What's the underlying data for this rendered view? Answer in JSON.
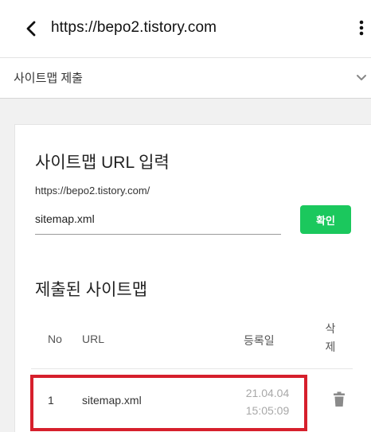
{
  "header": {
    "url": "https://bepo2.tistory.com",
    "back_icon": "chevron-left-icon",
    "more_icon": "vertical-ellipsis-icon"
  },
  "section": {
    "title": "사이트맵 제출",
    "icon": "chevron-down-icon"
  },
  "form": {
    "heading": "사이트맵 URL 입력",
    "base_url": "https://bepo2.tistory.com/",
    "input_value": "sitemap.xml",
    "confirm_label": "확인",
    "confirm_color": "#1bc85d"
  },
  "submitted": {
    "heading": "제출된 사이트맵",
    "columns": {
      "no": "No",
      "url": "URL",
      "date": "등록일",
      "delete_line1": "삭",
      "delete_line2": "제"
    },
    "rows": [
      {
        "no": "1",
        "url": "sitemap.xml",
        "date": "21.04.04",
        "time": "15:05:09",
        "delete_icon": "trash-icon"
      }
    ]
  },
  "highlight_color": "#d61f2c"
}
